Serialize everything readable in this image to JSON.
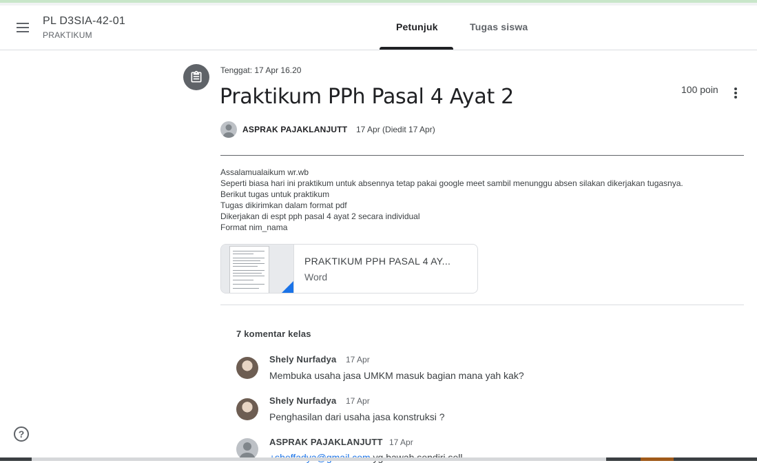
{
  "header": {
    "class_name": "PL D3SIA-42-01",
    "class_section": "PRAKTIKUM",
    "tabs": [
      {
        "label": "Petunjuk",
        "active": true
      },
      {
        "label": "Tugas siswa",
        "active": false
      }
    ]
  },
  "assignment": {
    "due": "Tenggat: 17 Apr 16.20",
    "title": "Praktikum PPh Pasal 4 Ayat 2",
    "points": "100 poin",
    "author": "ASPRAK PAJAKLANJUTT",
    "posted": "17 Apr (Diedit 17 Apr)",
    "description": [
      "Assalamualaikum wr.wb",
      "Seperti biasa hari ini praktikum untuk absennya tetap pakai google meet sambil menunggu absen silakan dikerjakan tugasnya.",
      "Berikut tugas untuk praktikum",
      "Tugas dikirimkan dalam format pdf",
      "Dikerjakan di espt pph pasal 4 ayat 2 secara individual",
      "Format nim_nama"
    ],
    "attachment": {
      "name": "PRAKTIKUM PPH PASAL 4 AY...",
      "type": "Word"
    }
  },
  "comments": {
    "heading": "7 komentar kelas",
    "items": [
      {
        "author": "Shely Nurfadya",
        "date": "17 Apr",
        "text": "Membuka usaha jasa UMKM masuk bagian mana yah kak?"
      },
      {
        "author": "Shely Nurfadya",
        "date": "17 Apr",
        "text": "Penghasilan dari usaha jasa konstruksi ?"
      },
      {
        "author": "ASPRAK PAJAKLANJUTT",
        "date": "17 Apr",
        "link": "+sheffadya@gmail.com",
        "text": " yg bawah sendiri sell"
      }
    ]
  },
  "colors": {
    "accent": "#1a73e8",
    "text": "#3c4043",
    "divider": "#dadce0"
  },
  "icons": [
    "menu-icon",
    "assignment-icon",
    "more-vert-icon",
    "help-icon",
    "word-file-icon"
  ]
}
